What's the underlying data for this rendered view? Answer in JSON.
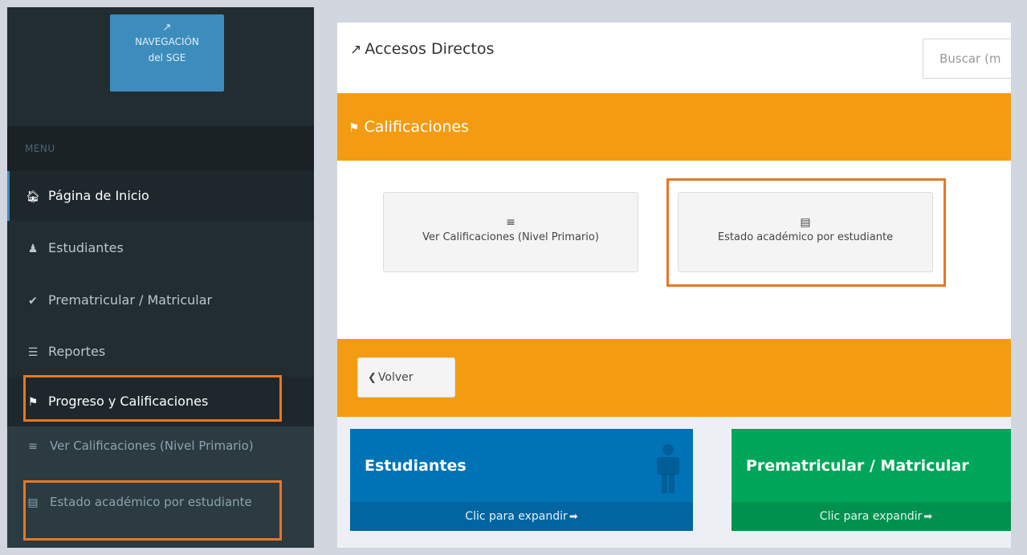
{
  "sidebar": {
    "nav_sge": {
      "line1": "NAVEGACIÓN",
      "line2": "del SGE",
      "icon": "external-link-icon"
    },
    "menu_header": "MENU",
    "items": [
      {
        "label": "Página de Inicio",
        "icon": "home-icon"
      },
      {
        "label": "Estudiantes",
        "icon": "user-icon"
      },
      {
        "label": "Prematricular / Matricular",
        "icon": "check-icon"
      },
      {
        "label": "Reportes",
        "icon": "file-text-icon"
      },
      {
        "label": "Progreso y Calificaciones",
        "icon": "flag-checkered-icon"
      }
    ],
    "submenu": [
      {
        "label": "Ver Calificaciones (Nivel Primario)",
        "icon": "list-ol-icon"
      },
      {
        "label": "Estado académico por estudiante",
        "icon": "file-icon"
      }
    ]
  },
  "main": {
    "title": "Accesos Directos",
    "title_icon": "external-link-icon",
    "search_placeholder": "Buscar (m",
    "section_title": "Calificaciones",
    "shortcuts": [
      {
        "label": "Ver Calificaciones (Nivel Primario)",
        "icon": "list-ol-icon"
      },
      {
        "label": "Estado académico por estudiante",
        "icon": "file-icon"
      }
    ],
    "back_label": "Volver",
    "boxes": [
      {
        "title": "Estudiantes",
        "footer": "Clic para expandir",
        "color": "#0073b7"
      },
      {
        "title": "Prematricular / Matricular",
        "footer": "Clic para expandir",
        "color": "#00a65a"
      }
    ]
  },
  "colors": {
    "sidebar_bg": "#222d32",
    "accent_orange": "#f39c12",
    "highlight_orange": "#e87722",
    "nav_blue": "#3c8dbc"
  }
}
